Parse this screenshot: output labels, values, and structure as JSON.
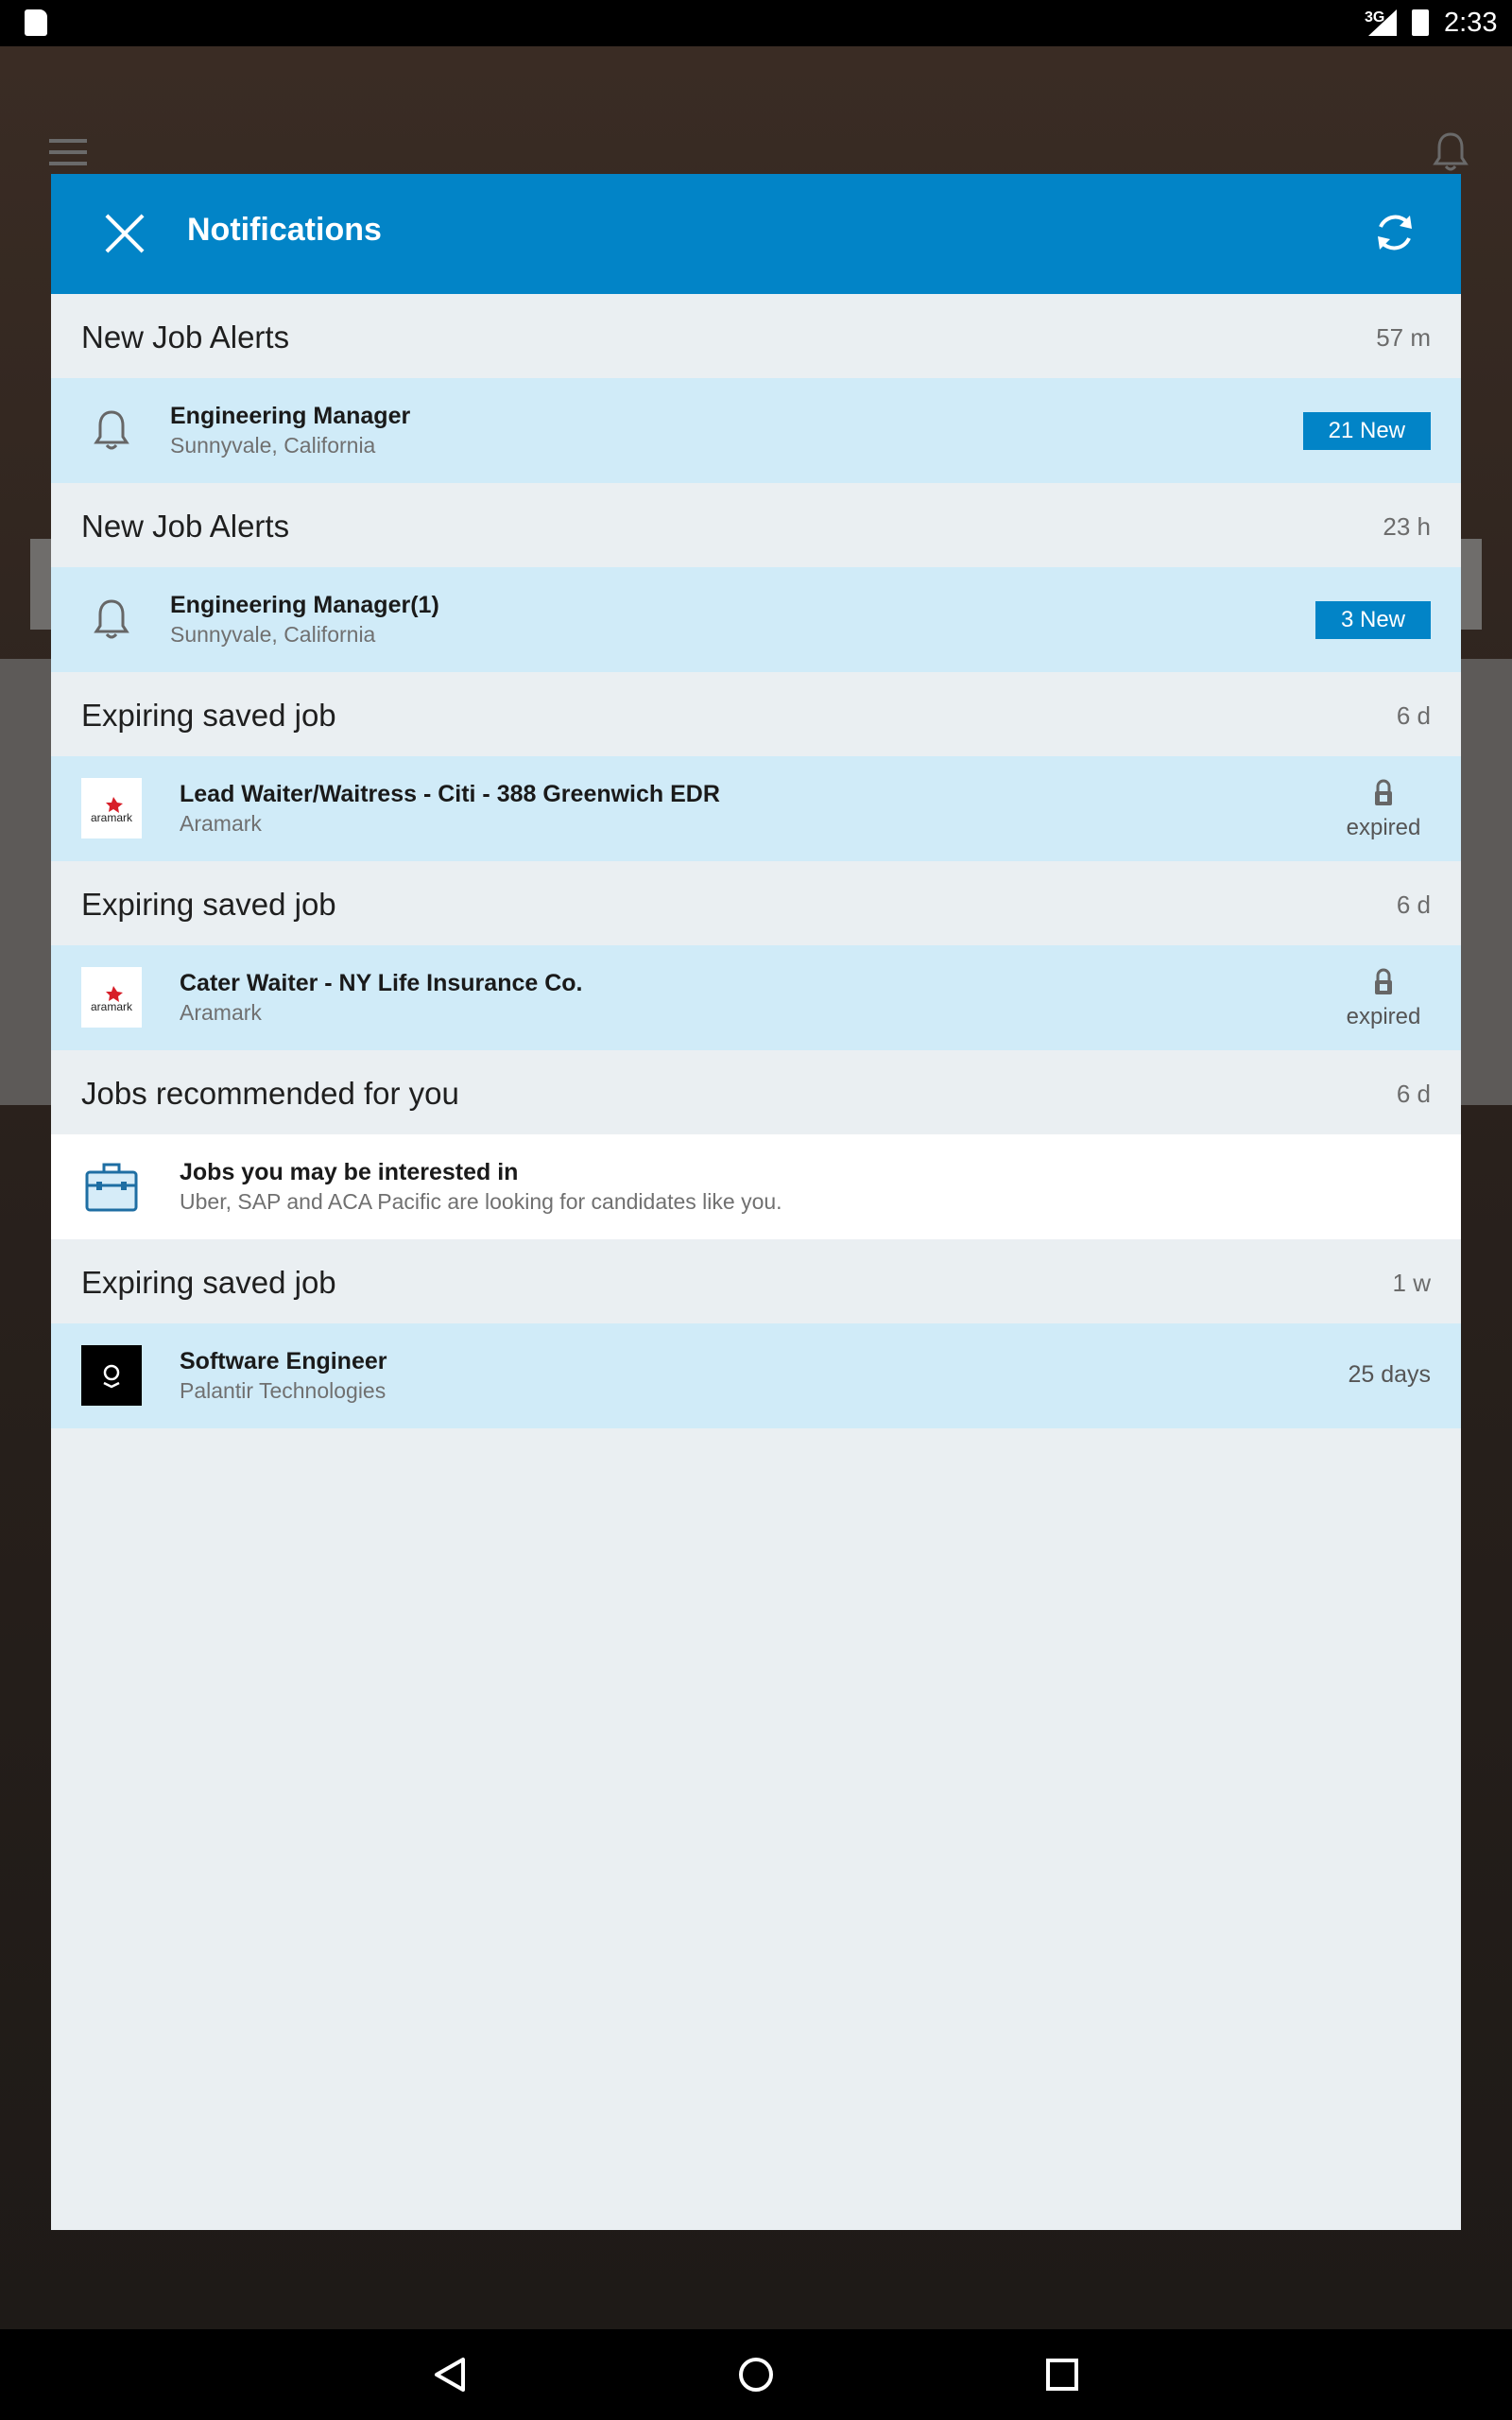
{
  "status_bar": {
    "network": "3G",
    "time": "2:33"
  },
  "notifications_panel": {
    "title": "Notifications",
    "close_icon": "close-icon",
    "refresh_icon": "refresh-icon",
    "accent_color": "#0284c7",
    "sections": [
      {
        "title": "New Job Alerts",
        "time": "57 m",
        "item": {
          "title": "Engineering Manager",
          "subtitle": "Sunnyvale, California",
          "badge": "21 New",
          "icon": "bell-icon"
        }
      },
      {
        "title": "New Job Alerts",
        "time": "23 h",
        "item": {
          "title": "Engineering Manager(1)",
          "subtitle": "Sunnyvale, California",
          "badge": "3 New",
          "icon": "bell-icon"
        }
      },
      {
        "title": "Expiring saved job",
        "time": "6 d",
        "item": {
          "title": "Lead Waiter/Waitress - Citi - 388 Greenwich EDR",
          "subtitle": "Aramark",
          "status": "expired",
          "logo": "aramark"
        }
      },
      {
        "title": "Expiring saved job",
        "time": "6 d",
        "item": {
          "title": "Cater Waiter - NY Life Insurance Co.",
          "subtitle": "Aramark",
          "status": "expired",
          "logo": "aramark"
        }
      },
      {
        "title": "Jobs recommended for you",
        "time": "6 d",
        "item": {
          "title": "Jobs you may be interested in",
          "subtitle": "Uber, SAP and ACA Pacific are looking for candidates like you.",
          "icon": "briefcase-icon"
        }
      },
      {
        "title": "Expiring saved job",
        "time": "1 w",
        "item": {
          "title": "Software Engineer",
          "subtitle": "Palantir Technologies",
          "status": "25 days",
          "logo": "palantir"
        }
      }
    ]
  },
  "aramark_logo_text": "aramark",
  "nav_bar": {
    "back_icon": "back-icon",
    "home_icon": "home-icon",
    "recents_icon": "recents-icon"
  }
}
